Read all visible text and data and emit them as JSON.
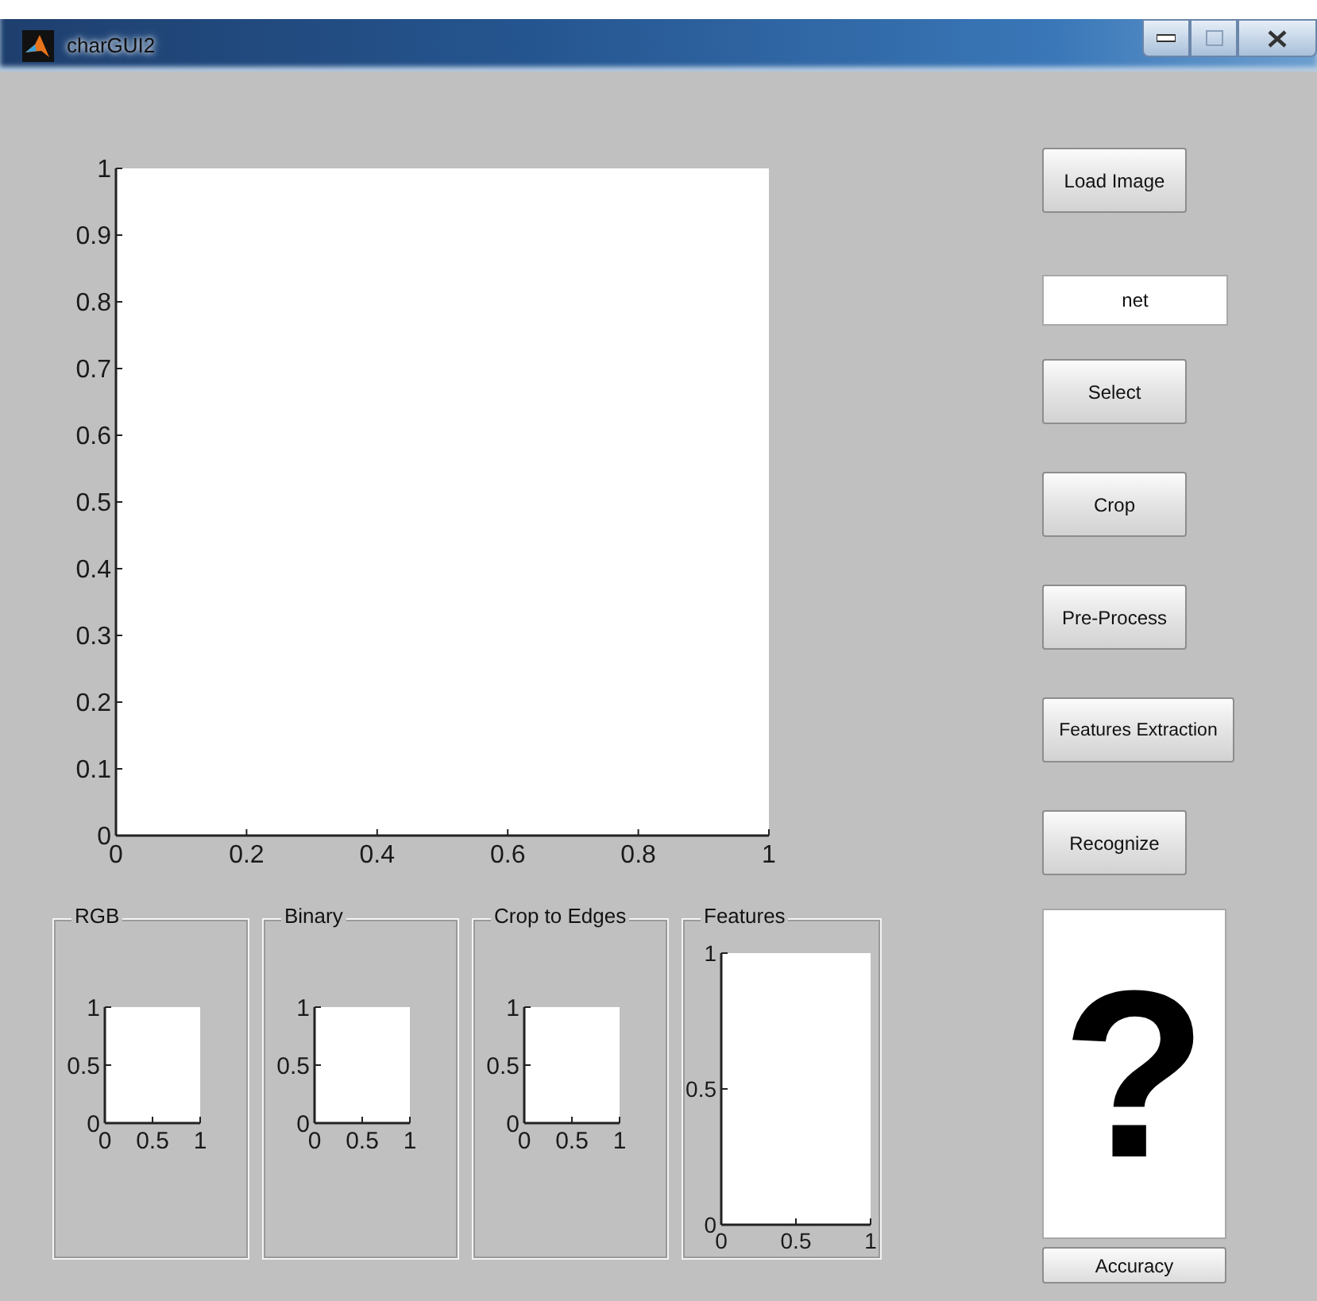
{
  "window": {
    "title": "charGUI2"
  },
  "main_axes": {
    "chart_data": {
      "type": "line",
      "xlim": [
        0,
        1
      ],
      "ylim": [
        0,
        1
      ],
      "xticks": [
        0,
        0.2,
        0.4,
        0.6,
        0.8,
        1
      ],
      "yticks": [
        0,
        0.1,
        0.2,
        0.3,
        0.4,
        0.5,
        0.6,
        0.7,
        0.8,
        0.9,
        1
      ]
    }
  },
  "panels": [
    {
      "kind": "small",
      "title": "RGB",
      "chart_data": {
        "type": "line",
        "xlim": [
          0,
          1
        ],
        "ylim": [
          0,
          1
        ],
        "xticks": [
          0,
          0.5,
          1
        ],
        "yticks": [
          0,
          0.5,
          1
        ]
      }
    },
    {
      "kind": "small",
      "title": "Binary",
      "chart_data": {
        "type": "line",
        "xlim": [
          0,
          1
        ],
        "ylim": [
          0,
          1
        ],
        "xticks": [
          0,
          0.5,
          1
        ],
        "yticks": [
          0,
          0.5,
          1
        ]
      }
    },
    {
      "kind": "small",
      "title": "Crop to Edges",
      "chart_data": {
        "type": "line",
        "xlim": [
          0,
          1
        ],
        "ylim": [
          0,
          1
        ],
        "xticks": [
          0,
          0.5,
          1
        ],
        "yticks": [
          0,
          0.5,
          1
        ]
      }
    },
    {
      "kind": "tall",
      "title": "Features",
      "chart_data": {
        "type": "line",
        "xlim": [
          0,
          1
        ],
        "ylim": [
          0,
          1
        ],
        "xticks": [
          0,
          0.5,
          1
        ],
        "yticks": [
          0,
          0.5,
          1
        ]
      }
    }
  ],
  "controls": [
    {
      "kind": "button",
      "label": "Load Image"
    },
    {
      "kind": "field",
      "value": "net"
    },
    {
      "kind": "button",
      "label": "Select"
    },
    {
      "kind": "button",
      "label": "Crop"
    },
    {
      "kind": "button",
      "label": "Pre-Process"
    },
    {
      "kind": "button",
      "label": "Features Extraction"
    },
    {
      "kind": "button",
      "label": "Recognize"
    }
  ],
  "result": {
    "text": "?"
  },
  "accuracy_button": {
    "label": "Accuracy"
  }
}
